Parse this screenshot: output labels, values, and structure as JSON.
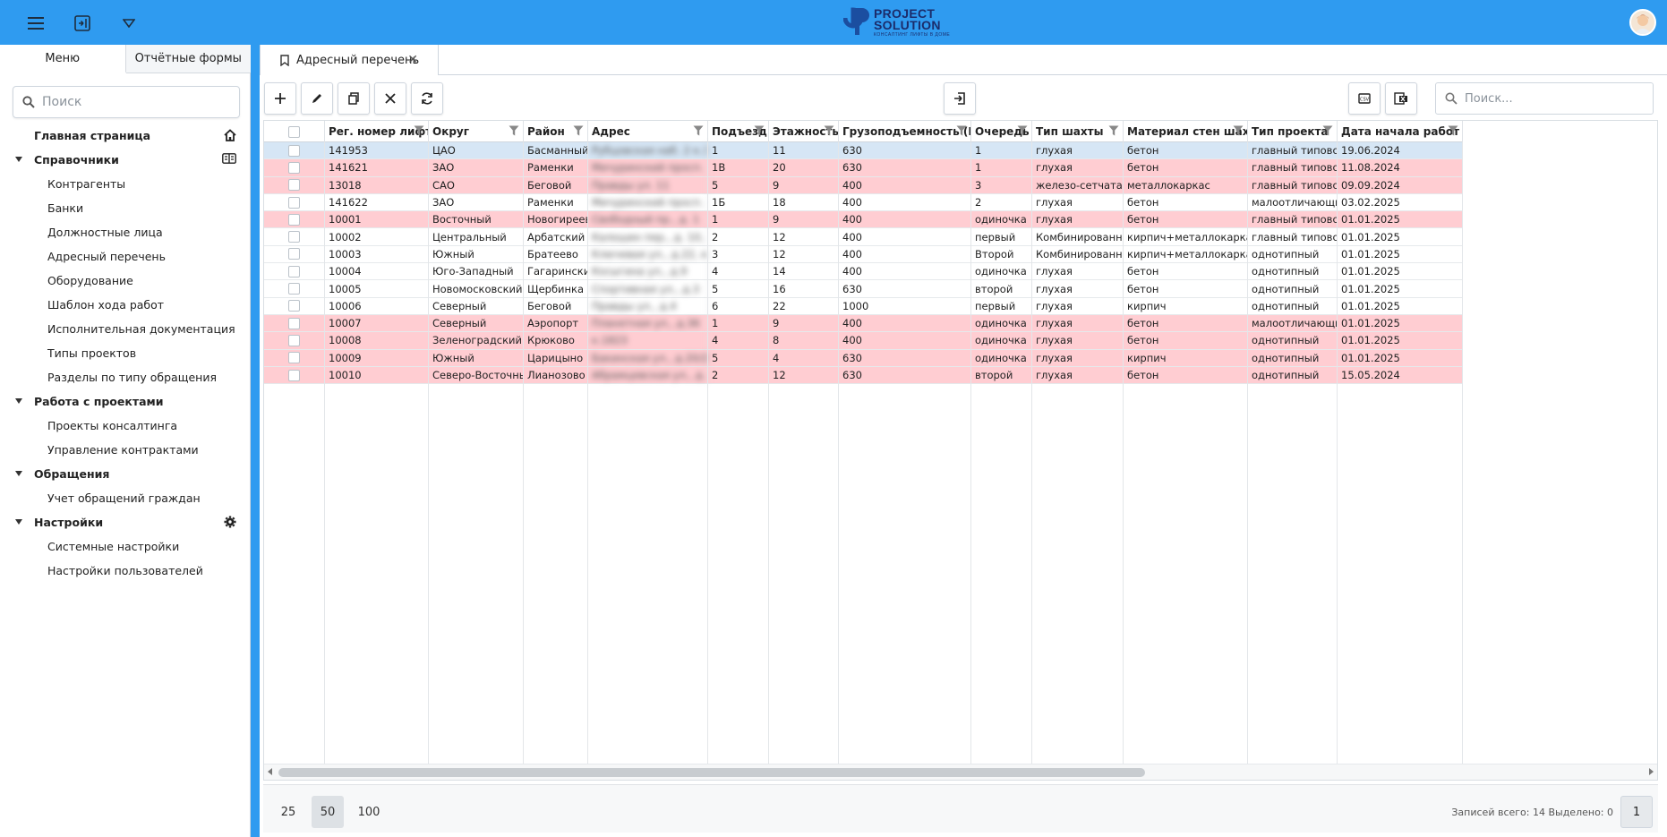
{
  "header": {
    "logo_line1": "PROJECT",
    "logo_line2": "SOLUTION",
    "logo_tagline": "КОНСАЛТИНГ ЛИФТЫ В ДОМЕ"
  },
  "left_panel": {
    "tabs": [
      {
        "label": "Меню"
      },
      {
        "label": "Отчётные формы"
      }
    ],
    "search_placeholder": "Поиск",
    "tree": [
      {
        "label": "Главная страница",
        "level": 0,
        "icon": "home-icon"
      },
      {
        "label": "Справочники",
        "level": 0,
        "expandable": true,
        "icon": "book-icon"
      },
      {
        "label": "Контрагенты",
        "level": 1
      },
      {
        "label": "Банки",
        "level": 1
      },
      {
        "label": "Должностные лица",
        "level": 1
      },
      {
        "label": "Адресный перечень",
        "level": 1
      },
      {
        "label": "Оборудование",
        "level": 1
      },
      {
        "label": "Шаблон хода работ",
        "level": 1
      },
      {
        "label": "Исполнительная документация",
        "level": 1
      },
      {
        "label": "Типы проектов",
        "level": 1
      },
      {
        "label": "Разделы по типу обращения",
        "level": 1
      },
      {
        "label": "Работа с проектами",
        "level": 0,
        "expandable": true
      },
      {
        "label": "Проекты консалтинга",
        "level": 1
      },
      {
        "label": "Управление контрактами",
        "level": 1
      },
      {
        "label": "Обращения",
        "level": 0,
        "expandable": true
      },
      {
        "label": "Учет обращений граждан",
        "level": 1
      },
      {
        "label": "Настройки",
        "level": 0,
        "expandable": true,
        "icon": "gear-icon"
      },
      {
        "label": "Системные настройки",
        "level": 1
      },
      {
        "label": "Настройки пользователей",
        "level": 1
      }
    ]
  },
  "tab": {
    "label": "Адресный перечень"
  },
  "search": {
    "placeholder": "Поиск..."
  },
  "grid": {
    "columns": [
      "Рег. номер лифта",
      "Округ",
      "Район",
      "Адрес",
      "Подъезд",
      "Этажность",
      "Грузоподъемность (Г/П)",
      "Очередь",
      "Тип шахты",
      "Материал стен шахты",
      "Тип проекта",
      "Дата начала работ"
    ],
    "rows": [
      {
        "status": "selected",
        "cells": [
          "141953",
          "ЦАО",
          "Басманный",
          "Рубцовская наб. 2 к.3",
          "1",
          "11",
          "630",
          "1",
          "глухая",
          "бетон",
          "главный типовой",
          "19.06.2024"
        ]
      },
      {
        "status": "pink",
        "cells": [
          "141621",
          "ЗАО",
          "Раменки",
          "Мичуринский просп. 9 к.1",
          "1В",
          "20",
          "630",
          "1",
          "глухая",
          "бетон",
          "главный типовой",
          "11.08.2024"
        ]
      },
      {
        "status": "pink",
        "cells": [
          "13018",
          "САО",
          "Беговой",
          "Правды ул. 11",
          "5",
          "9",
          "400",
          "3",
          "железо-сетчатая",
          "металлокаркас",
          "главный типовой",
          "09.09.2024"
        ]
      },
      {
        "status": "normal",
        "cells": [
          "141622",
          "ЗАО",
          "Раменки",
          "Мичуринский просп. 9 к.1",
          "1Б",
          "18",
          "400",
          "2",
          "глухая",
          "бетон",
          "малоотличающийся",
          "03.02.2025"
        ]
      },
      {
        "status": "pink",
        "cells": [
          "10001",
          "Восточный",
          "Новогиреево",
          "Свободный пр., д. 1",
          "1",
          "9",
          "400",
          "одиночка",
          "глухая",
          "бетон",
          "главный типовой",
          "01.01.2025"
        ]
      },
      {
        "status": "normal",
        "cells": [
          "10002",
          "Центральный",
          "Арбатский",
          "Калошин пер., д. 10, с.1",
          "2",
          "12",
          "400",
          "первый",
          "Комбинированная",
          "кирпич+металлокаркас",
          "главный типовой",
          "01.01.2025"
        ]
      },
      {
        "status": "normal",
        "cells": [
          "10003",
          "Южный",
          "Братеево",
          "Ключевая ул., д.22, к.1",
          "3",
          "12",
          "400",
          "Второй",
          "Комбинированная",
          "кирпич+металлокаркас",
          "однотипный",
          "01.01.2025"
        ]
      },
      {
        "status": "normal",
        "cells": [
          "10004",
          "Юго-Западный",
          "Гагаринский",
          "Косыгина ул., д.9",
          "4",
          "14",
          "400",
          "одиночка",
          "глухая",
          "бетон",
          "однотипный",
          "01.01.2025"
        ]
      },
      {
        "status": "normal",
        "cells": [
          "10005",
          "Новомосковский",
          "Щербинка",
          "Спортивная ул., д.3",
          "5",
          "16",
          "630",
          "второй",
          "глухая",
          "бетон",
          "однотипный",
          "01.01.2025"
        ]
      },
      {
        "status": "normal",
        "cells": [
          "10006",
          "Северный",
          "Беговой",
          "Правды ул., д.4",
          "6",
          "22",
          "1000",
          "первый",
          "глухая",
          "кирпич",
          "однотипный",
          "01.01.2025"
        ]
      },
      {
        "status": "pink",
        "cells": [
          "10007",
          "Северный",
          "Аэропорт",
          "Планетная ул., д.36",
          "1",
          "9",
          "400",
          "одиночка",
          "глухая",
          "бетон",
          "малоотличающийся",
          "01.01.2025"
        ]
      },
      {
        "status": "pink",
        "cells": [
          "10008",
          "Зеленоградский",
          "Крюково",
          "к.1823",
          "4",
          "8",
          "400",
          "одиночка",
          "глухая",
          "бетон",
          "однотипный",
          "01.01.2025"
        ]
      },
      {
        "status": "pink",
        "cells": [
          "10009",
          "Южный",
          "Царицыно",
          "Бакинская ул., д.20/2к2",
          "5",
          "4",
          "630",
          "одиночка",
          "глухая",
          "кирпич",
          "однотипный",
          "01.01.2025"
        ]
      },
      {
        "status": "pink",
        "cells": [
          "10010",
          "Северо-Восточный",
          "Лианозово",
          "Абрамцевская ул., д.18",
          "2",
          "12",
          "630",
          "второй",
          "глухая",
          "бетон",
          "однотипный",
          "15.05.2024"
        ]
      }
    ]
  },
  "pager": {
    "sizes": [
      "25",
      "50",
      "100"
    ],
    "active_size": "50",
    "info": "Записей всего: 14 Выделено: 0",
    "page": "1"
  },
  "colors": {
    "topbar": "#2f9bf0",
    "row_alert": "#ffcdd2",
    "row_selected": "#d6e6f5"
  }
}
